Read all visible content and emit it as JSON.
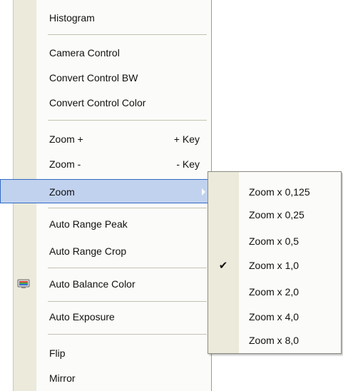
{
  "main_menu": {
    "items": [
      {
        "label": "Histogram",
        "accel": ""
      },
      {
        "label": "Camera Control",
        "accel": ""
      },
      {
        "label": "Convert Control BW",
        "accel": ""
      },
      {
        "label": "Convert Control Color",
        "accel": ""
      },
      {
        "label": "Zoom +",
        "accel": "+ Key"
      },
      {
        "label": "Zoom -",
        "accel": "- Key"
      },
      {
        "label": "Zoom",
        "accel": "",
        "has_submenu": true,
        "highlighted": true
      },
      {
        "label": "Auto Range Peak",
        "accel": ""
      },
      {
        "label": "Auto Range Crop",
        "accel": ""
      },
      {
        "label": "Auto Balance Color",
        "accel": "",
        "icon": "color-balance-icon"
      },
      {
        "label": "Auto Exposure",
        "accel": ""
      },
      {
        "label": "Flip",
        "accel": ""
      },
      {
        "label": "Mirror",
        "accel": ""
      }
    ]
  },
  "zoom_submenu": {
    "items": [
      {
        "label": "Zoom x 0,125",
        "checked": false
      },
      {
        "label": "Zoom x 0,25",
        "checked": false
      },
      {
        "label": "Zoom x 0,5",
        "checked": false
      },
      {
        "label": "Zoom x 1,0",
        "checked": true
      },
      {
        "label": "Zoom x 2,0",
        "checked": false
      },
      {
        "label": "Zoom x 4,0",
        "checked": false
      },
      {
        "label": "Zoom x 8,0",
        "checked": false
      }
    ],
    "check_glyph": "✔"
  },
  "colors": {
    "highlight_bg": "#c1d2ee",
    "highlight_border": "#316ac5",
    "gutter": "#ebeadb",
    "menu_bg": "#fbfbf9"
  }
}
